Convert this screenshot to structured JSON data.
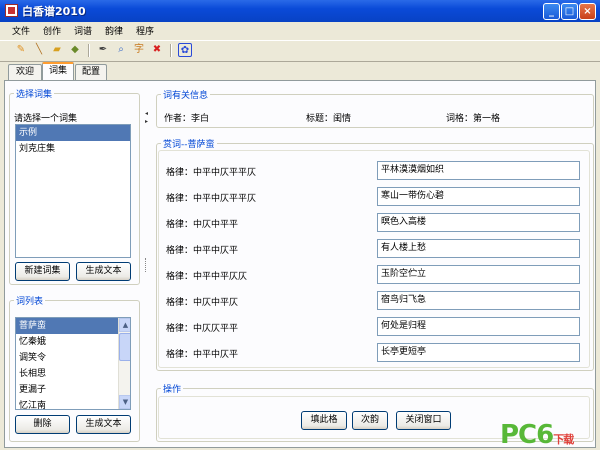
{
  "window": {
    "title": "白香谱2010",
    "controls": [
      "_",
      "□",
      "×"
    ]
  },
  "menu": [
    "文件",
    "创作",
    "词谱",
    "韵律",
    "程序"
  ],
  "toolbar": {
    "icons": [
      "pencil-icon",
      "brush-icon",
      "folder-icon",
      "book-icon",
      "pen-icon",
      "search-icon",
      "dictionary-icon",
      "delete-icon",
      "baidu-icon"
    ]
  },
  "tabs": [
    {
      "label": "欢迎",
      "active": false
    },
    {
      "label": "词集",
      "active": true
    },
    {
      "label": "配置",
      "active": false
    }
  ],
  "left": {
    "select_title": "选择词集",
    "prompt": "请选择一个词集",
    "collections": [
      {
        "label": "示例",
        "selected": true
      },
      {
        "label": "刘克庄集",
        "selected": false
      }
    ],
    "new_button": "新建词集",
    "generate_button": "生成文本",
    "list_title": "词列表",
    "poems": [
      {
        "label": "菩萨蛮",
        "selected": true
      },
      {
        "label": "忆秦娥",
        "selected": false
      },
      {
        "label": "调笑令",
        "selected": false
      },
      {
        "label": "长相思",
        "selected": false
      },
      {
        "label": "更漏子",
        "selected": false
      },
      {
        "label": "忆江南",
        "selected": false
      }
    ],
    "delete_button": "删除",
    "generate_button2": "生成文本"
  },
  "info": {
    "title": "词有关信息",
    "author": "作者：李白",
    "heading": "标题：闺情",
    "form": "词格：第一格"
  },
  "appreciate": {
    "title": "赏词--菩萨蛮",
    "rows": [
      {
        "label": "格律：中平中仄平平仄",
        "value": "平林漠漠烟如织"
      },
      {
        "label": "格律：中平中仄平平仄",
        "value": "寒山一带伤心碧"
      },
      {
        "label": "格律：中仄中平平",
        "value": "暝色入高楼"
      },
      {
        "label": "格律：中平中仄平",
        "value": "有人楼上愁"
      },
      {
        "label": "格律：中平中平仄仄",
        "value": "玉阶空伫立"
      },
      {
        "label": "格律：中仄中平仄",
        "value": "宿鸟归飞急"
      },
      {
        "label": "格律：中仄仄平平",
        "value": "何处是归程"
      },
      {
        "label": "格律：中平中仄平",
        "value": "长亭更短亭"
      }
    ]
  },
  "operation": {
    "title": "操作",
    "buttons": [
      "填此格",
      "次韵",
      "关闭窗口"
    ]
  },
  "watermark": {
    "main": "PC6",
    "sub": "下载"
  }
}
